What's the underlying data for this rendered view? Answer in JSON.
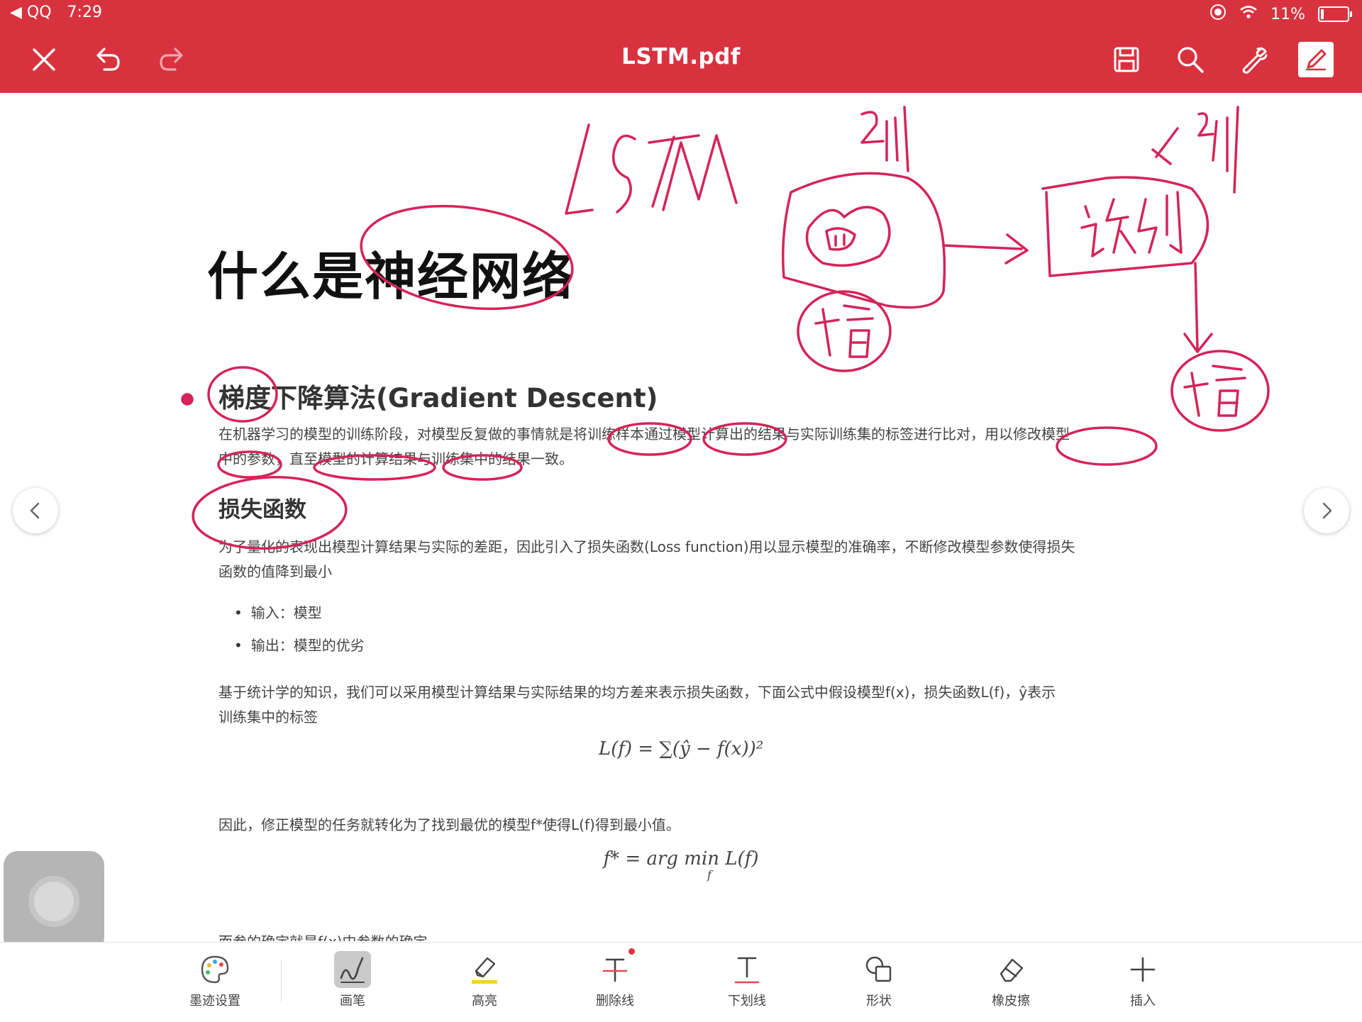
{
  "status": {
    "back_app": "◀ QQ",
    "time": "7:29",
    "battery_text": "11%",
    "battery_level": 0.11
  },
  "appbar": {
    "title": "LSTM.pdf",
    "buttons": [
      "close-icon",
      "undo-icon",
      "redo-icon",
      "save-icon",
      "search-icon",
      "wrench-icon",
      "edit-icon"
    ]
  },
  "document": {
    "h1": "什么是神经网络",
    "h2": "梯度下降算法(Gradient Descent)",
    "p1_line1": "在机器学习的模型的训练阶段，对模型反复做的事情就是将训练样本通过模型计算出的结果与实际训练集的标签进行比对，用以修改模型",
    "p1_line2": "中的参数，直至模型的计算结果与训练集中的结果一致。",
    "h3": "损失函数",
    "p2_line1": "为了量化的表现出模型计算结果与实际的差距，因此引入了损失函数(Loss function)用以显示模型的准确率，不断修改模型参数使得损失",
    "p2_line2": "函数的值降到最小",
    "bullets": [
      "输入：模型",
      "输出：模型的优劣"
    ],
    "p3_line1": "基于统计学的知识，我们可以采用模型计算结果与实际结果的均方差来表示损失函数，下面公式中假设模型f(x)，损失函数L(f)，ŷ表示",
    "p3_line2": "训练集中的标签",
    "formula1": "L(f) = ∑(ŷ − f(x))²",
    "p4": "因此，修正模型的任务就转化为了找到最优的模型f*使得L(f)得到最小值。",
    "formula2": "f* = arg min L(f)",
    "formula2_sub": "f",
    "p5_partial": "而参的确定就是f(x)中参数的确定"
  },
  "ink_color": "#d4245a",
  "toolbar": {
    "items": [
      {
        "label": "墨迹设置",
        "icon": "palette-icon"
      },
      {
        "label": "画笔",
        "icon": "pen-icon"
      },
      {
        "label": "高亮",
        "icon": "highlighter-icon"
      },
      {
        "label": "删除线",
        "icon": "strikethrough-icon"
      },
      {
        "label": "下划线",
        "icon": "underline-icon"
      },
      {
        "label": "形状",
        "icon": "shape-icon"
      },
      {
        "label": "橡皮擦",
        "icon": "eraser-icon"
      },
      {
        "label": "插入",
        "icon": "plus-icon"
      }
    ]
  }
}
